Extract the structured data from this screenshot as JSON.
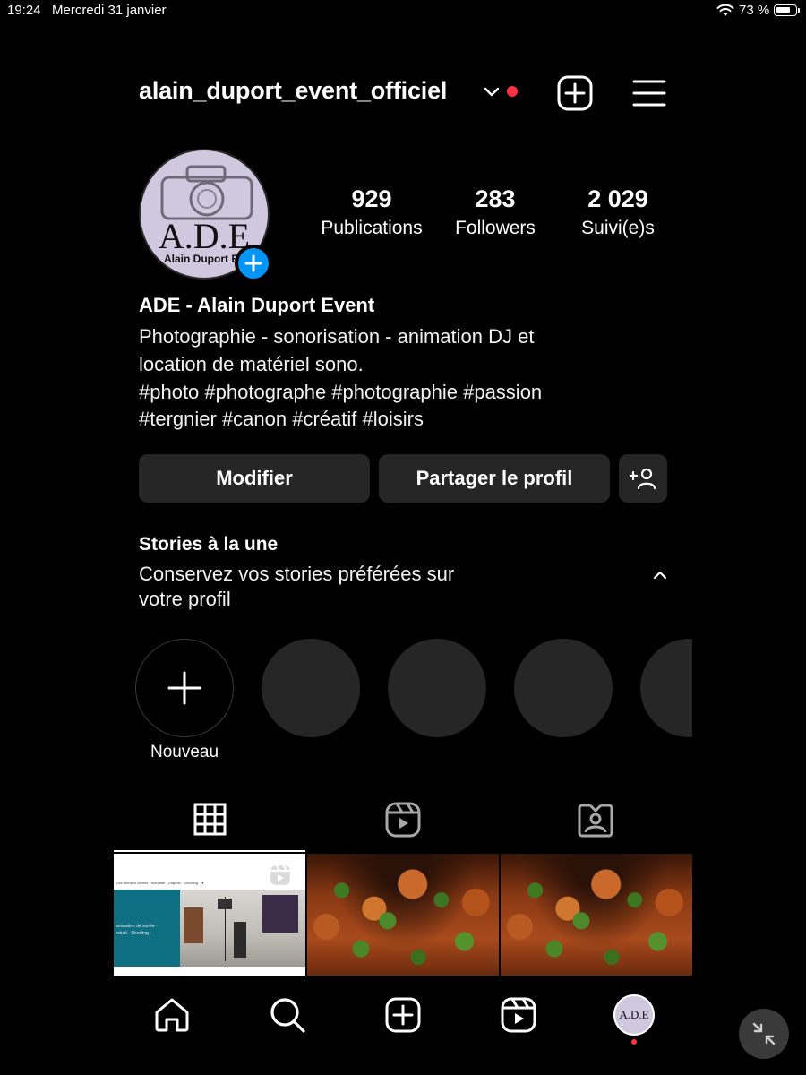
{
  "status_bar": {
    "time": "19:24",
    "date": "Mercredi 31 janvier",
    "battery": "73 %",
    "battery_level": 0.73
  },
  "header": {
    "username": "alain_duport_event_officiel",
    "accent_dot_color": "#ff3040"
  },
  "avatar": {
    "logo_text": "A.D.E",
    "logo_subtext": "Alain Duport Event"
  },
  "stats": [
    {
      "value": "929",
      "label": "Publications"
    },
    {
      "value": "283",
      "label": "Followers"
    },
    {
      "value": "2 029",
      "label": "Suivi(e)s"
    }
  ],
  "bio": {
    "name": "ADE - Alain Duport Event",
    "lines": [
      "Photographie - sonorisation - animation DJ et",
      "location de matériel sono.",
      "#photo #photographe #photographie #passion",
      "#tergnier #canon #créatif #loisirs"
    ]
  },
  "actions": {
    "edit": "Modifier",
    "share": "Partager le profil"
  },
  "stories": {
    "title": "Stories à la une",
    "subtitle_lines": [
      "Conservez vos stories préférées sur",
      "votre profil"
    ],
    "new_label": "Nouveau"
  },
  "tabs": [
    "grid-icon",
    "reels-icon",
    "tagged-icon"
  ],
  "grid": {
    "post1": {
      "nav_text": "Les derniers clichés · Actualité · Graphic · Shooting · ▼",
      "caption_lines": [
        "animation de soirée -",
        "ortrait - Shooting -"
      ],
      "accent_color": "#0e6e82"
    }
  },
  "bottom_nav": [
    "home-icon",
    "search-icon",
    "create-icon",
    "reels-icon",
    "profile-avatar"
  ]
}
